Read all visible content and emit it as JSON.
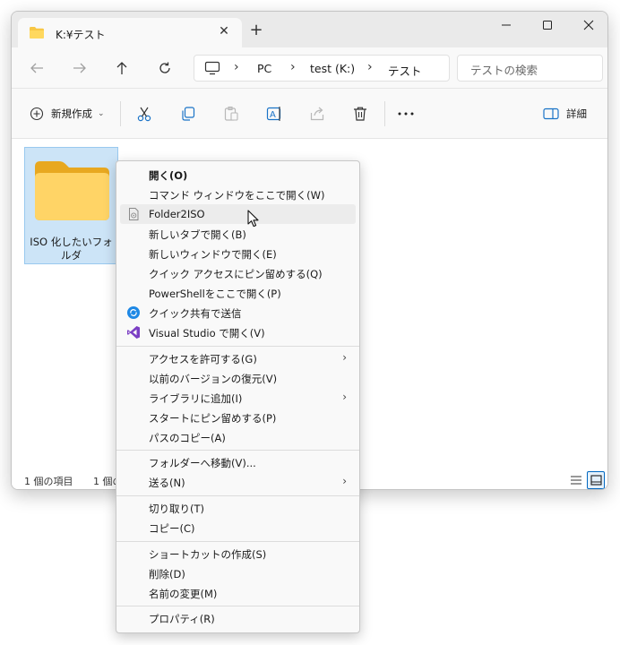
{
  "tab": {
    "title": "K:¥テスト"
  },
  "address": {
    "crumbs": [
      "PC",
      "test (K:)",
      "テスト"
    ]
  },
  "search": {
    "placeholder": "テストの検索"
  },
  "toolbar": {
    "new_label": "新規作成",
    "details_label": "詳細"
  },
  "folder": {
    "name": "ISO 化したいフォルダ"
  },
  "status": {
    "count": "1 個の項目",
    "selected": "1 個の"
  },
  "colors": {
    "accent": "#0067c0",
    "folder": "#f8c745",
    "selection": "#cce4f7"
  },
  "menu": {
    "items": [
      {
        "label": "開く(O)",
        "icon": null,
        "submenu": false
      },
      {
        "label": "コマンド ウィンドウをここで開く(W)",
        "icon": null,
        "submenu": false
      },
      {
        "label": "Folder2ISO",
        "icon": "document-icon",
        "submenu": false
      },
      {
        "label": "新しいタブで開く(B)",
        "icon": null,
        "submenu": false
      },
      {
        "label": "新しいウィンドウで開く(E)",
        "icon": null,
        "submenu": false
      },
      {
        "label": "クイック アクセスにピン留めする(Q)",
        "icon": null,
        "submenu": false
      },
      {
        "label": "PowerShellをここで開く(P)",
        "icon": null,
        "submenu": false
      },
      {
        "label": "クイック共有で送信",
        "icon": "quick-share-icon",
        "submenu": false
      },
      {
        "label": "Visual Studio で開く(V)",
        "icon": "visual-studio-icon",
        "submenu": false
      },
      {
        "label": "アクセスを許可する(G)",
        "icon": null,
        "submenu": true
      },
      {
        "label": "以前のバージョンの復元(V)",
        "icon": null,
        "submenu": false
      },
      {
        "label": "ライブラリに追加(I)",
        "icon": null,
        "submenu": true
      },
      {
        "label": "スタートにピン留めする(P)",
        "icon": null,
        "submenu": false
      },
      {
        "label": "パスのコピー(A)",
        "icon": null,
        "submenu": false
      },
      {
        "label": "フォルダーへ移動(V)...",
        "icon": null,
        "submenu": false
      },
      {
        "label": "送る(N)",
        "icon": null,
        "submenu": true
      },
      {
        "label": "切り取り(T)",
        "icon": null,
        "submenu": false
      },
      {
        "label": "コピー(C)",
        "icon": null,
        "submenu": false
      },
      {
        "label": "ショートカットの作成(S)",
        "icon": null,
        "submenu": false
      },
      {
        "label": "削除(D)",
        "icon": null,
        "submenu": false
      },
      {
        "label": "名前の変更(M)",
        "icon": null,
        "submenu": false
      },
      {
        "label": "プロパティ(R)",
        "icon": null,
        "submenu": false
      }
    ]
  }
}
